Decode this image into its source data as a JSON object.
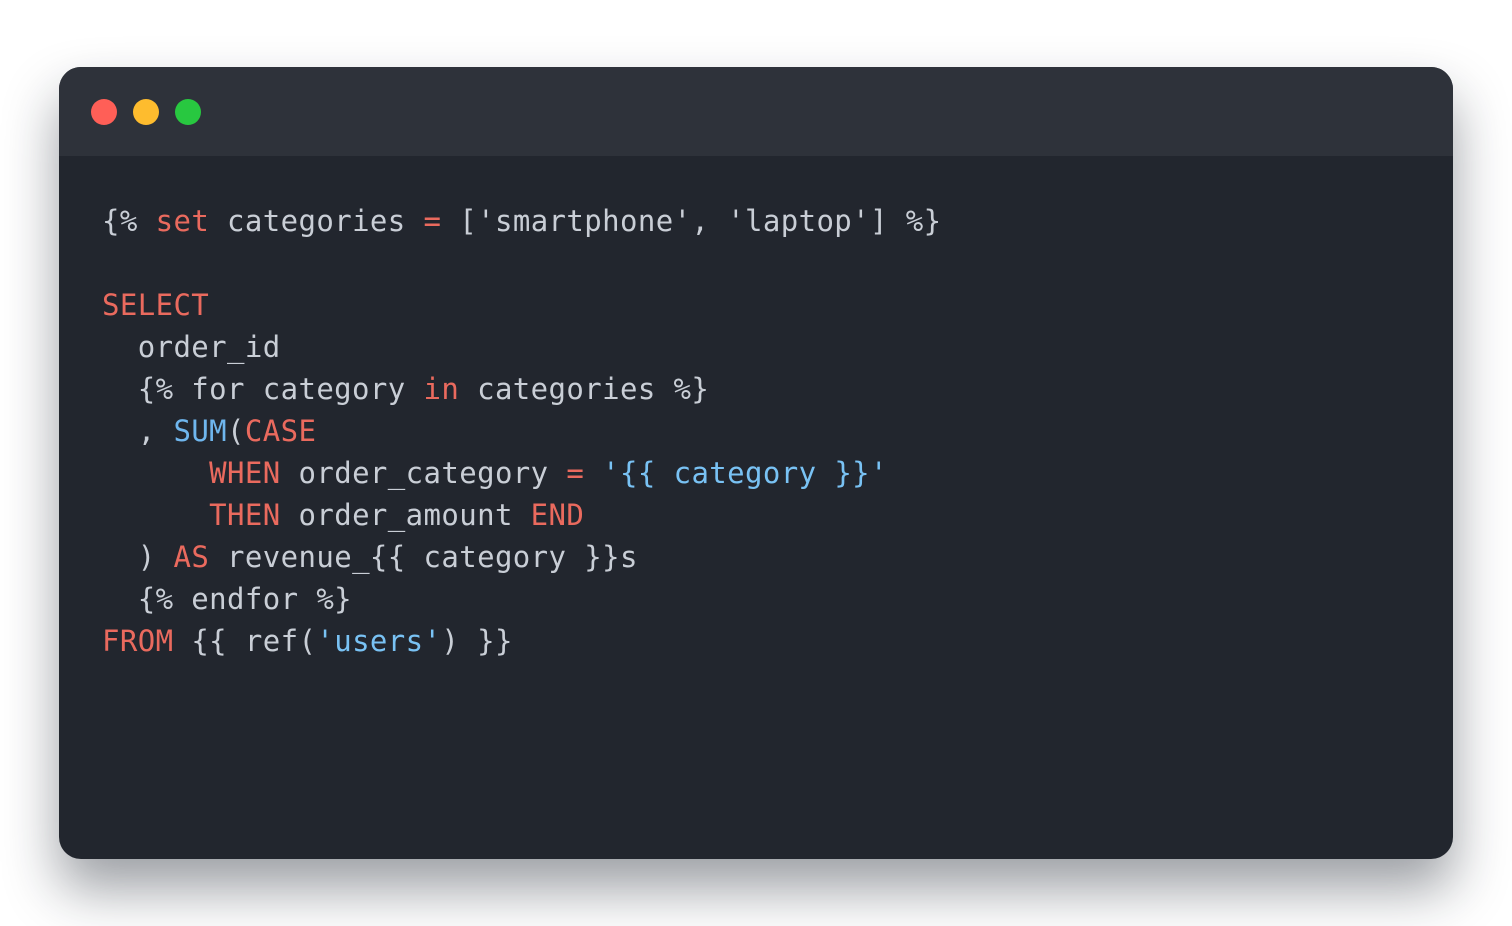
{
  "colors": {
    "editor_background": "#22262e",
    "titlebar_background": "#2e323a",
    "plain_text": "#c9ced6",
    "keyword": "#ea6a5e",
    "function": "#6fb6ee",
    "string": "#79c2f4"
  },
  "window": {
    "buttons": [
      {
        "name": "close-button",
        "color": "#ff5f57"
      },
      {
        "name": "minimize-button",
        "color": "#febc2e"
      },
      {
        "name": "maximize-button",
        "color": "#28c840"
      }
    ]
  },
  "code": {
    "language": "jinja-sql",
    "lines": [
      [
        {
          "t": "{% ",
          "c": "plain"
        },
        {
          "t": "set",
          "c": "kw"
        },
        {
          "t": " categories ",
          "c": "plain"
        },
        {
          "t": "=",
          "c": "kw"
        },
        {
          "t": " ['smartphone', 'laptop'] %}",
          "c": "plain"
        }
      ],
      [],
      [
        {
          "t": "SELECT",
          "c": "kw"
        }
      ],
      [
        {
          "t": "  order_id",
          "c": "plain"
        }
      ],
      [
        {
          "t": "  {% for category ",
          "c": "plain"
        },
        {
          "t": "in",
          "c": "kw"
        },
        {
          "t": " categories %}",
          "c": "plain"
        }
      ],
      [
        {
          "t": "  , ",
          "c": "plain"
        },
        {
          "t": "SUM",
          "c": "fn"
        },
        {
          "t": "(",
          "c": "plain"
        },
        {
          "t": "CASE",
          "c": "kw"
        }
      ],
      [
        {
          "t": "      ",
          "c": "plain"
        },
        {
          "t": "WHEN",
          "c": "kw"
        },
        {
          "t": " order_category ",
          "c": "plain"
        },
        {
          "t": "=",
          "c": "kw"
        },
        {
          "t": " ",
          "c": "plain"
        },
        {
          "t": "'{{ category }}'",
          "c": "str"
        }
      ],
      [
        {
          "t": "      ",
          "c": "plain"
        },
        {
          "t": "THEN",
          "c": "kw"
        },
        {
          "t": " order_amount ",
          "c": "plain"
        },
        {
          "t": "END",
          "c": "kw"
        }
      ],
      [
        {
          "t": "  ) ",
          "c": "plain"
        },
        {
          "t": "AS",
          "c": "kw"
        },
        {
          "t": " revenue_{{ category }}s",
          "c": "plain"
        }
      ],
      [
        {
          "t": "  {% endfor %}",
          "c": "plain"
        }
      ],
      [
        {
          "t": "FROM",
          "c": "kw"
        },
        {
          "t": " {{ ref(",
          "c": "plain"
        },
        {
          "t": "'users'",
          "c": "str"
        },
        {
          "t": ") }}",
          "c": "plain"
        }
      ]
    ]
  }
}
